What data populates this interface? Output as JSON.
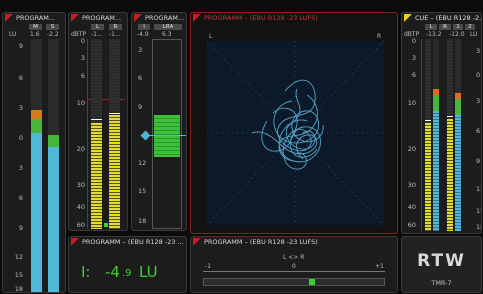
{
  "panels": {
    "prog1": {
      "title": "PROGRAM...",
      "hdr_labels": [
        "M",
        "S"
      ],
      "unit": "LU",
      "values": [
        "1.6",
        "-2.2"
      ]
    },
    "prog2": {
      "title": "PROGRAM...",
      "hdr_labels": [
        "L",
        "R"
      ],
      "unit": "dBTP",
      "values": [
        "-1...",
        "-1..."
      ]
    },
    "prog3": {
      "title": "PROGRAM...",
      "hdr_labels": [
        "I",
        "LRA"
      ],
      "values": [
        "-4.9",
        "6.3"
      ]
    },
    "vector": {
      "title": "PROGRAMM – (EBU R128 -23 LUFS)",
      "left_label": "L",
      "right_label": "R"
    },
    "cue": {
      "title": "CUE – (EBU R128 -2...",
      "hdr_labels": [
        "L",
        "R",
        "1",
        "2"
      ],
      "unit_left": "dBTP",
      "unit_right": "LU",
      "values": [
        "-13.2",
        "-12.0"
      ]
    },
    "loudness": {
      "title": "PROGRAMM – (EBU R128 -23 ...",
      "label": "I:",
      "value_int": "-4",
      "value_dec": ".9",
      "unit": "LU"
    },
    "correlation": {
      "title": "PROGRAMM – (EBU R128 -23 LUFS)",
      "label": "L <> R",
      "ticks": [
        "-1",
        "0",
        "+1"
      ],
      "level": 0.2
    },
    "logo": {
      "brand": "RTW",
      "model": "TMR-7"
    }
  },
  "scales": {
    "lu": [
      "9",
      "6",
      "3",
      "0",
      "3",
      "6",
      "9",
      "12",
      "15",
      "18"
    ],
    "dbtp": [
      "0",
      "3",
      "6",
      "10",
      "20",
      "30",
      "40",
      "60"
    ],
    "lra": [
      "3",
      "6",
      "9",
      "12",
      "15",
      "18"
    ]
  },
  "colors": {
    "accent_red": "#c51f1f",
    "accent_yellow": "#e7d21f",
    "value_green": "#3fcf37",
    "meter_blue": "#4fb8d8",
    "meter_yellow": "#e0dc33"
  }
}
